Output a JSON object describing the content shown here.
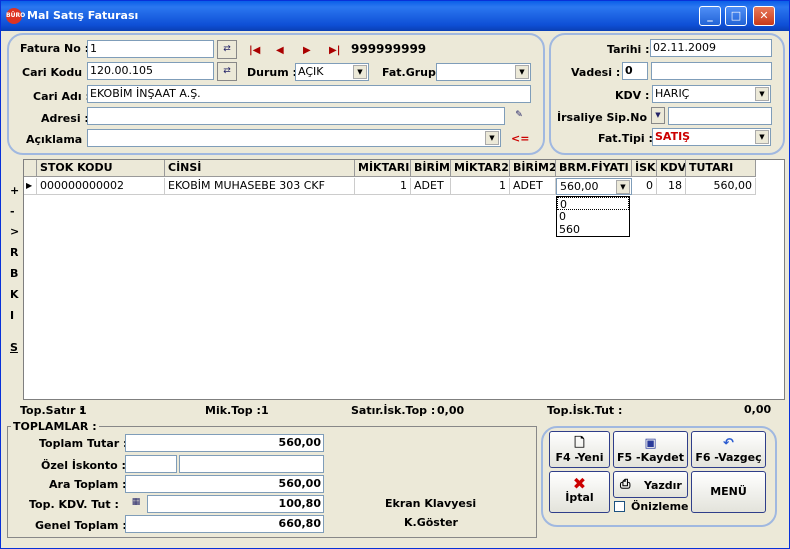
{
  "window": {
    "title": "Mal Satış Faturası",
    "icon_text": "BÜRO"
  },
  "header": {
    "fatura_no_label": "Fatura No :",
    "fatura_no": "1",
    "cari_kodu_label": "Cari Kodu :",
    "cari_kodu": "120.00.105",
    "cari_adi_label": "Cari Adı :",
    "cari_adi": "EKOBİM İNŞAAT A.Ş.",
    "adresi_label": "Adresi :",
    "adresi": "",
    "aciklama_label": "Açıklama :",
    "aciklama": "",
    "aciklama_arrow": "<=",
    "counter": "999999999",
    "durum_label": "Durum :",
    "durum": "AÇIK",
    "fat_grup_label": "Fat.Grup:",
    "fat_grup": ""
  },
  "right_panel": {
    "tarihi_label": "Tarihi :",
    "tarihi": "02.11.2009",
    "vadesi_label": "Vadesi :",
    "vadesi_days": "0",
    "vadesi_date": "",
    "kdv_label": "KDV :",
    "kdv": "HARIÇ",
    "irsaliye_label": "İrsaliye Sip.No :",
    "irsaliye": "",
    "fat_tipi_label": "Fat.Tipi :",
    "fat_tipi": "SATIŞ"
  },
  "side_buttons": [
    "+",
    "-",
    ">",
    "R",
    "B",
    "K",
    "I",
    "S"
  ],
  "table": {
    "columns": [
      "STOK KODU",
      "CİNSİ",
      "MİKTARI",
      "BİRİM",
      "MİKTAR2",
      "BİRİM2",
      "BRM.FİYATI",
      "İSK",
      "KDV",
      "TUTARI"
    ],
    "rows": [
      {
        "stok_kodu": "000000000002",
        "cinsi": "EKOBİM MUHASEBE 303 CKF",
        "miktari": "1",
        "birim": "ADET",
        "miktar2": "1",
        "birim2": "ADET",
        "brm_fiyati": "560,00",
        "isk": "0",
        "kdv": "18",
        "tutari": "560,00"
      }
    ],
    "price_dropdown_options": [
      "0",
      "0",
      "560"
    ]
  },
  "summary": {
    "top_satir_label": "Top.Satır :",
    "top_satir": "1",
    "mik_top_label": "Mik.Top :",
    "mik_top": "1",
    "satir_isk_label": "Satır.İsk.Top :",
    "satir_isk": "0,00",
    "top_isk_label": "Top.İsk.Tut :",
    "top_isk": "0,00"
  },
  "totals": {
    "group_label": "TOPLAMLAR :",
    "toplam_tutar_label": "Toplam Tutar :",
    "toplam_tutar": "560,00",
    "ozel_iskonto_label": "Özel İskonto :",
    "ozel_iskonto_a": "",
    "ozel_iskonto_b": "",
    "ara_toplam_label": "Ara Toplam :",
    "ara_toplam": "560,00",
    "kdv_tut_label": "Top. KDV. Tut :",
    "kdv_tut": "100,80",
    "genel_toplam_label": "Genel Toplam :",
    "genel_toplam": "660,80",
    "klavye_label": "Ekran Klavyesi",
    "goster_label": "K.Göster"
  },
  "actions": {
    "new": "F4 -Yeni",
    "save": "F5 -Kaydet",
    "cancel": "F6 -Vazgeç",
    "delete": "İptal",
    "print": "Yazdır",
    "preview": "Önizleme",
    "menu": "MENÜ"
  }
}
